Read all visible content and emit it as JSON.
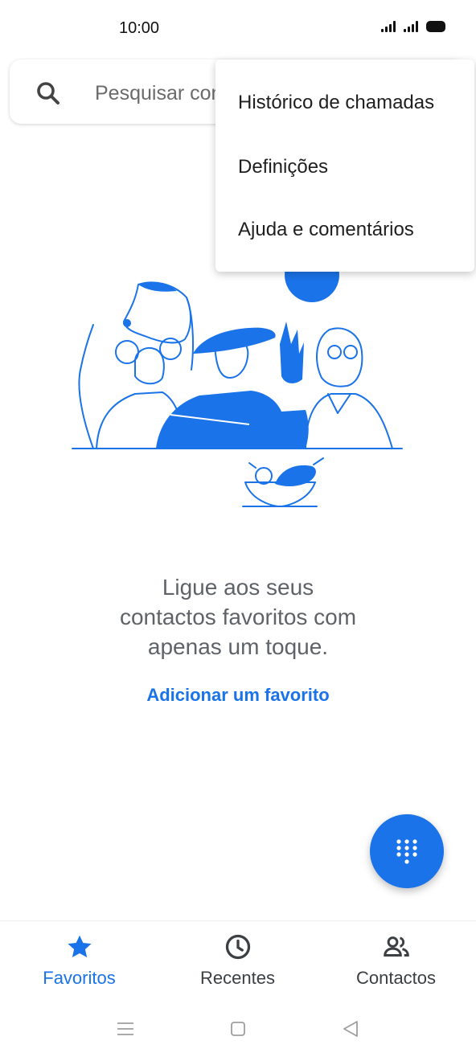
{
  "status_bar": {
    "time": "10:00"
  },
  "search": {
    "placeholder": "Pesquisar con"
  },
  "overflow_menu": {
    "items": [
      {
        "label": "Histórico de chamadas"
      },
      {
        "label": "Definições"
      },
      {
        "label": "Ajuda e comentários"
      }
    ]
  },
  "empty_state": {
    "message_line1": "Ligue aos seus",
    "message_line2": "contactos favoritos com",
    "message_line3": "apenas um toque.",
    "add_favorite_label": "Adicionar um favorito"
  },
  "fab": {
    "icon": "dialpad-icon"
  },
  "bottom_nav": {
    "tabs": [
      {
        "label": "Favoritos",
        "icon": "star-icon",
        "active": true
      },
      {
        "label": "Recentes",
        "icon": "clock-icon",
        "active": false
      },
      {
        "label": "Contactos",
        "icon": "people-icon",
        "active": false
      }
    ]
  },
  "colors": {
    "accent": "#1a73e8",
    "text_secondary": "#5f6368"
  }
}
